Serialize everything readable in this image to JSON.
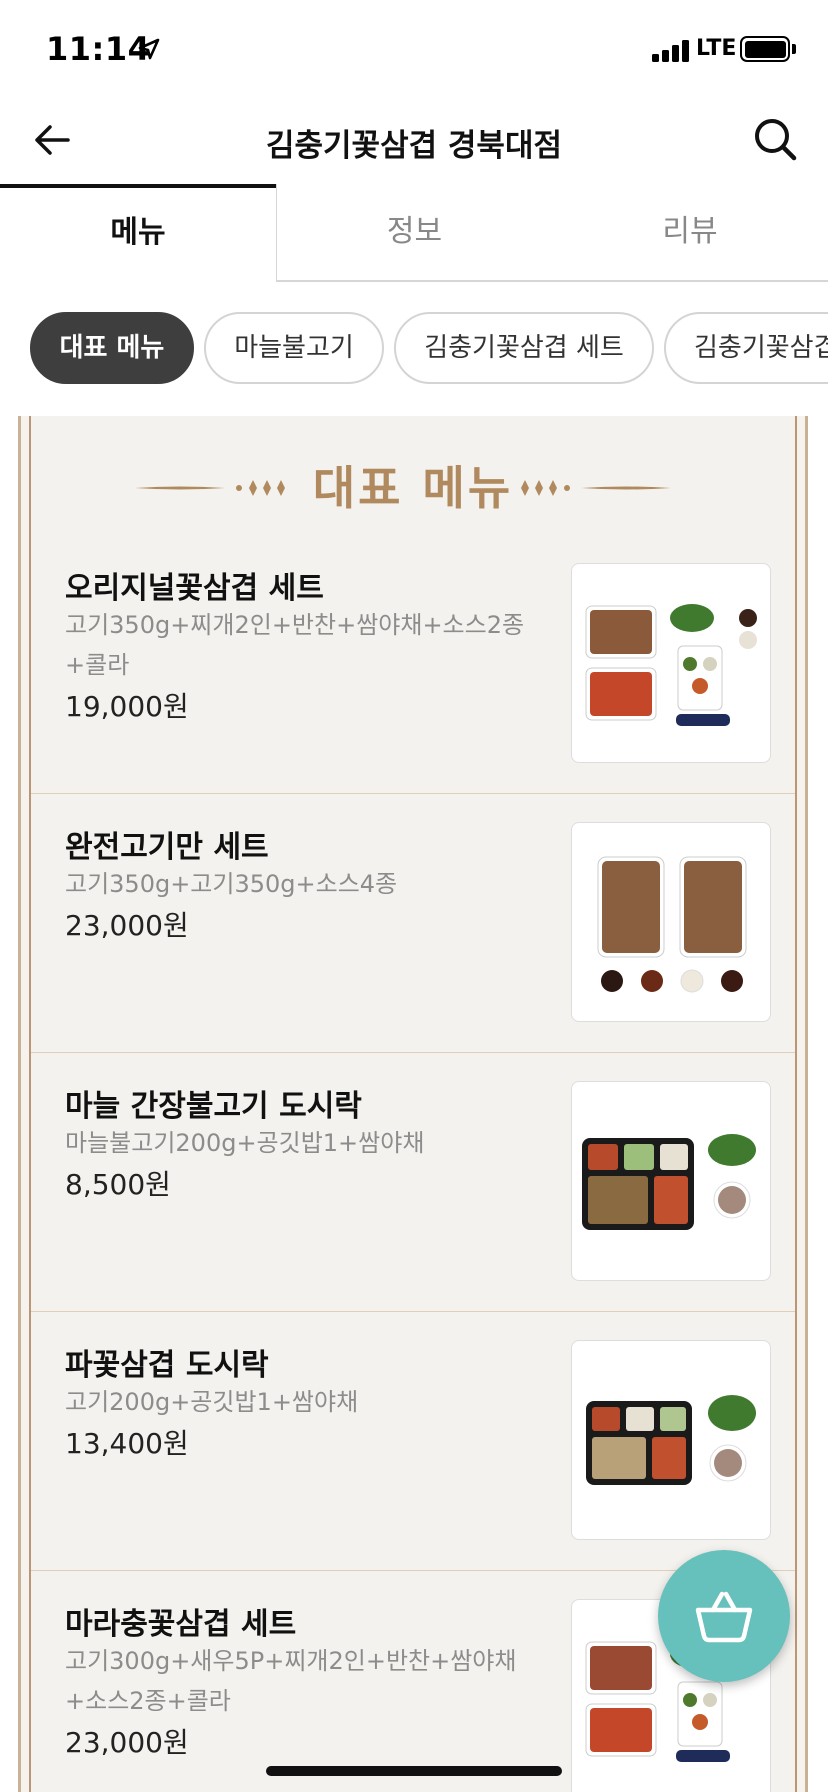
{
  "status_bar": {
    "time": "11:14",
    "network": "LTE",
    "icons": [
      "location-arrow-icon",
      "signal-icon",
      "battery-icon"
    ]
  },
  "header": {
    "title": "김충기꽃삼겹 경북대점",
    "back_icon": "arrow-left-icon",
    "search_icon": "search-icon"
  },
  "tabs": [
    {
      "label": "메뉴",
      "active": true
    },
    {
      "label": "정보",
      "active": false
    },
    {
      "label": "리뷰",
      "active": false
    }
  ],
  "chips": [
    {
      "label": "대표 메뉴",
      "active": true
    },
    {
      "label": "마늘불고기",
      "active": false
    },
    {
      "label": "김충기꽃삼겹 세트",
      "active": false
    },
    {
      "label": "김충기꽃삼겹",
      "active": false
    }
  ],
  "section": {
    "title": "대표 메뉴"
  },
  "menu_items": [
    {
      "name": "오리지널꽃삼겹 세트",
      "desc": "고기350g+찌개2인+반찬+쌈야채+소스2종+콜라",
      "price": "19,000원"
    },
    {
      "name": "완전고기만 세트",
      "desc": "고기350g+고기350g+소스4종",
      "price": "23,000원"
    },
    {
      "name": "마늘 간장불고기 도시락",
      "desc": "마늘불고기200g+공깃밥1+쌈야채",
      "price": "8,500원"
    },
    {
      "name": "파꽃삼겹 도시락",
      "desc": "고기200g+공깃밥1+쌈야채",
      "price": "13,400원"
    },
    {
      "name": "마라충꽃삼겹 세트",
      "desc": "고기300g+새우5P+찌개2인+반찬+쌈야채+소스2종+콜라",
      "price": "23,000원"
    }
  ],
  "cart_icon": "shopping-basket-icon",
  "colors": {
    "accent_gold": "#b08a5e",
    "chip_active_bg": "#3e3e3e",
    "cart_fab": "#66c0bb"
  }
}
